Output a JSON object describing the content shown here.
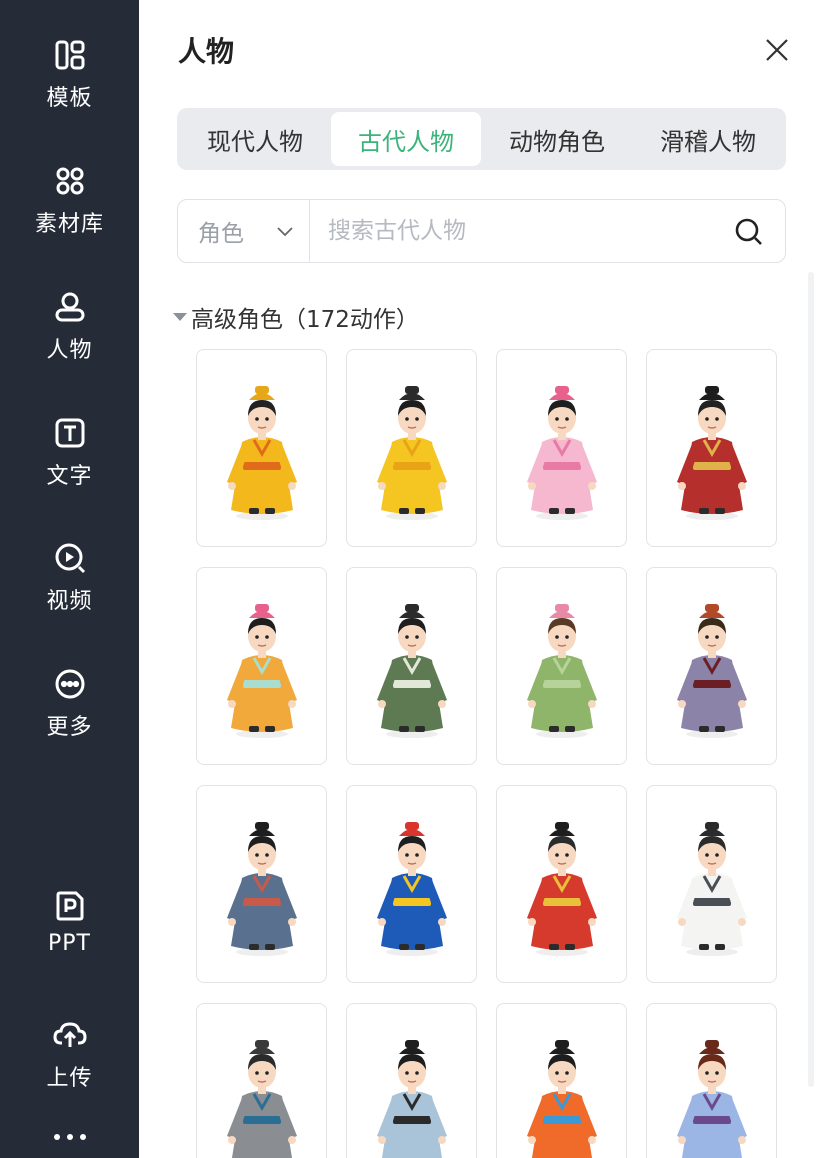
{
  "sidebar": {
    "items": [
      {
        "label": "模板",
        "icon": "layout-icon"
      },
      {
        "label": "素材库",
        "icon": "materials-icon"
      },
      {
        "label": "人物",
        "icon": "user-icon"
      },
      {
        "label": "文字",
        "icon": "text-icon"
      },
      {
        "label": "视频",
        "icon": "video-icon"
      },
      {
        "label": "更多",
        "icon": "more-circle-icon"
      },
      {
        "label": "PPT",
        "icon": "ppt-icon"
      },
      {
        "label": "上传",
        "icon": "cloud-upload-icon"
      }
    ],
    "more_icon": "ellipsis-icon"
  },
  "panel": {
    "title": "人物",
    "close_icon": "close-icon",
    "tabs": [
      {
        "label": "现代人物",
        "active": false
      },
      {
        "label": "古代人物",
        "active": true
      },
      {
        "label": "动物角色",
        "active": false
      },
      {
        "label": "滑稽人物",
        "active": false
      }
    ],
    "search": {
      "select_value": "角色",
      "placeholder": "搜索古代人物",
      "value": ""
    },
    "section": {
      "label": "高级角色（172动作）"
    },
    "characters": [
      {
        "name": "emperor-yellow",
        "robe": "#f2b81c",
        "accent": "#e06b1b",
        "hat": "#e6a817",
        "hair": "#222222"
      },
      {
        "name": "qing-empress-yellow",
        "robe": "#f5c522",
        "accent": "#e8a317",
        "hat": "#2b2b2b",
        "hair": "#1e1e1e"
      },
      {
        "name": "princess-pink",
        "robe": "#f5b8cf",
        "accent": "#e87aa5",
        "hat": "#e8618d",
        "hair": "#1e1e1e"
      },
      {
        "name": "official-red",
        "robe": "#b5302c",
        "accent": "#e0b34a",
        "hat": "#1d1d1d",
        "hair": "#222222"
      },
      {
        "name": "lady-orange",
        "robe": "#f0a93a",
        "accent": "#a8ddd0",
        "hat": "#e8618d",
        "hair": "#1e1e1e"
      },
      {
        "name": "qing-lady-green",
        "robe": "#5e7a52",
        "accent": "#e2e8d8",
        "hat": "#2b2b2b",
        "hair": "#1e1e1e"
      },
      {
        "name": "maid-green",
        "robe": "#8fb56a",
        "accent": "#b7d39a",
        "hat": "#e889a8",
        "hair": "#5a3a22"
      },
      {
        "name": "general-armor",
        "robe": "#8c84a8",
        "accent": "#6b1f25",
        "hat": "#b24a2a",
        "hair": "#3a2a1a"
      },
      {
        "name": "swordsman-blue",
        "robe": "#59708f",
        "accent": "#c85a4a",
        "hat": "#1e1e1e",
        "hair": "#1e1e1e"
      },
      {
        "name": "qing-official-blue",
        "robe": "#1e5bb8",
        "accent": "#f5c522",
        "hat": "#d9352c",
        "hair": "#1e1e1e"
      },
      {
        "name": "judge-red",
        "robe": "#d63a2c",
        "accent": "#e8c03a",
        "hat": "#1e1e1e",
        "hair": "#2b2b2b"
      },
      {
        "name": "scholar-white",
        "robe": "#f4f5f2",
        "accent": "#4a4f55",
        "hat": "#2b2b2b",
        "hair": "#2b2b2b"
      },
      {
        "name": "servant-gray",
        "robe": "#8a8e92",
        "accent": "#2a6f93",
        "hat": "#3a3a3a",
        "hair": "#2b2b2b"
      },
      {
        "name": "scholar-lightblue",
        "robe": "#a9c4d8",
        "accent": "#2b2b2b",
        "hat": "#1e1e1e",
        "hair": "#1e1e1e"
      },
      {
        "name": "boy-orange",
        "robe": "#f06a2a",
        "accent": "#3b9ad6",
        "hat": "#1e1e1e",
        "hair": "#1e1e1e"
      },
      {
        "name": "youth-blue",
        "robe": "#9bb6e4",
        "accent": "#6a4a8a",
        "hat": "#6a2a1a",
        "hair": "#6a2a1a"
      }
    ]
  },
  "colors": {
    "sidebar_bg": "#252c38",
    "accent_green": "#3cb37a",
    "tab_bar_bg": "#e9ebee"
  }
}
